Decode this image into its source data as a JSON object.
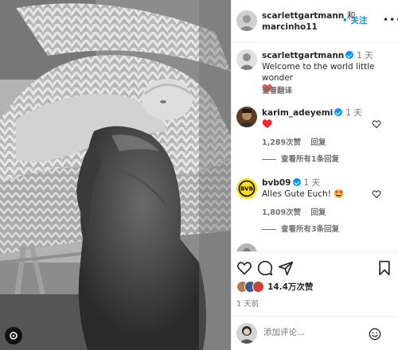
{
  "header": {
    "user1": "scarlettgartmann",
    "conj": "和",
    "user2": "marcinho11",
    "follow_label": "• 关注",
    "more": "•••"
  },
  "caption": {
    "username": "scarlettgartmann",
    "time": "1 天",
    "text": "Welcome to the world little wonder",
    "emoji": "❤️",
    "translate": "查看翻译"
  },
  "comments": [
    {
      "username": "karim_adeyemi",
      "time": "1 天",
      "text": "♥️",
      "likes": "1,289次赞",
      "reply": "回复",
      "view_replies": "查看所有1条回复"
    },
    {
      "username": "bvb09",
      "time": "1 天",
      "text": "Alles Gute Euch!",
      "emoji": "🤩",
      "likes": "1,809次赞",
      "reply": "回复",
      "view_replies": "查看所有3条回复"
    }
  ],
  "actions": {
    "likes": "14.4万次赞",
    "date": "1 天前"
  },
  "add_comment": {
    "placeholder": "添加评论..."
  },
  "colors": {
    "accent": "#0095f6",
    "secondary_text": "#737373",
    "bvb_yellow": "#fde100",
    "heart_red": "#ed4956"
  }
}
